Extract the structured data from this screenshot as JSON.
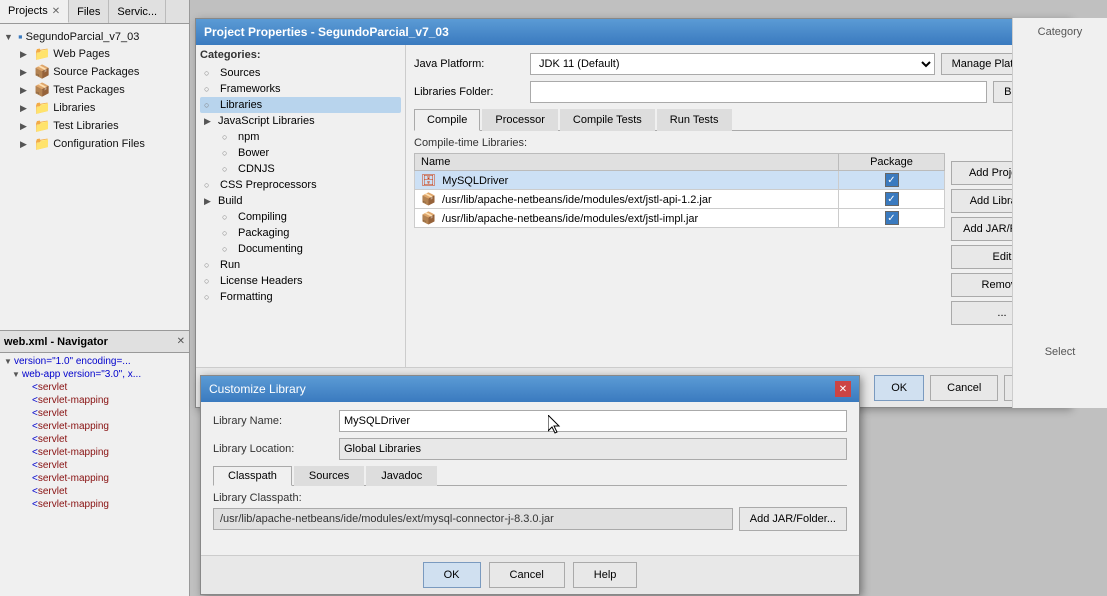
{
  "app": {
    "title": "Project Properties - SegundoParcial_v7_03"
  },
  "tabs": {
    "projects": "Projects",
    "files": "Files",
    "services": "Servic..."
  },
  "left_panel": {
    "project_name": "SegundoParcial_v7_03",
    "tree_items": [
      {
        "label": "Web Pages",
        "icon": "folder",
        "depth": 1
      },
      {
        "label": "Source Packages",
        "icon": "pkg",
        "depth": 1
      },
      {
        "label": "Test Packages",
        "icon": "pkg",
        "depth": 1
      },
      {
        "label": "Libraries",
        "icon": "folder",
        "depth": 1
      },
      {
        "label": "Test Libraries",
        "icon": "folder",
        "depth": 1
      },
      {
        "label": "Configuration Files",
        "icon": "folder",
        "depth": 1
      }
    ]
  },
  "navigator": {
    "title": "web.xml - Navigator",
    "tree_items": [
      {
        "label": "version=\"1.0\" encoding=...",
        "type": "xml",
        "depth": 0
      },
      {
        "label": "web-app version=\"3.0\", x...",
        "type": "xml",
        "depth": 1
      },
      {
        "label": "servlet",
        "type": "tag",
        "depth": 2
      },
      {
        "label": "servlet-mapping",
        "type": "tag",
        "depth": 2
      },
      {
        "label": "servlet",
        "type": "tag",
        "depth": 2
      },
      {
        "label": "servlet-mapping",
        "type": "tag",
        "depth": 2
      },
      {
        "label": "servlet",
        "type": "tag",
        "depth": 2
      },
      {
        "label": "servlet-mapping",
        "type": "tag",
        "depth": 2
      },
      {
        "label": "servlet",
        "type": "tag",
        "depth": 2
      },
      {
        "label": "servlet-mapping",
        "type": "tag",
        "depth": 2
      },
      {
        "label": "servlet",
        "type": "tag",
        "depth": 2
      },
      {
        "label": "servlet-mapping",
        "type": "tag",
        "depth": 2
      }
    ]
  },
  "main_dialog": {
    "title": "Project Properties - SegundoParcial_v7_03",
    "categories_label": "Categories:",
    "categories": [
      {
        "label": "Sources",
        "depth": 0,
        "selected": false
      },
      {
        "label": "Frameworks",
        "depth": 0,
        "selected": false
      },
      {
        "label": "Libraries",
        "depth": 0,
        "selected": true
      },
      {
        "label": "JavaScript Libraries",
        "depth": 0,
        "selected": false
      },
      {
        "label": "npm",
        "depth": 1,
        "selected": false
      },
      {
        "label": "Bower",
        "depth": 1,
        "selected": false
      },
      {
        "label": "CDNJS",
        "depth": 1,
        "selected": false
      },
      {
        "label": "CSS Preprocessors",
        "depth": 0,
        "selected": false
      },
      {
        "label": "Build",
        "depth": 0,
        "selected": false
      },
      {
        "label": "Compiling",
        "depth": 1,
        "selected": false
      },
      {
        "label": "Packaging",
        "depth": 1,
        "selected": false
      },
      {
        "label": "Documenting",
        "depth": 1,
        "selected": false
      },
      {
        "label": "Run",
        "depth": 0,
        "selected": false
      },
      {
        "label": "License Headers",
        "depth": 0,
        "selected": false
      },
      {
        "label": "Formatting",
        "depth": 0,
        "selected": false
      }
    ],
    "java_platform_label": "Java Platform:",
    "java_platform_value": "JDK 11 (Default)",
    "libraries_folder_label": "Libraries Folder:",
    "libraries_folder_value": "",
    "manage_platforms_btn": "Manage Platforms...",
    "browse_btn": "Browse...",
    "tabs": [
      "Compile",
      "Processor",
      "Compile Tests",
      "Run Tests"
    ],
    "active_tab": "Compile",
    "compile_time_label": "Compile-time Libraries:",
    "table_headers": [
      "Name",
      "Package"
    ],
    "libraries": [
      {
        "name": "MySQLDriver",
        "path": "",
        "type": "db",
        "checked": true,
        "selected": true
      },
      {
        "name": "",
        "path": "/usr/lib/apache-netbeans/ide/modules/ext/jstl-api-1.2.jar",
        "type": "jar",
        "checked": true,
        "selected": false
      },
      {
        "name": "",
        "path": "/usr/lib/apache-netbeans/ide/modules/ext/jstl-impl.jar",
        "type": "jar",
        "checked": true,
        "selected": false
      }
    ],
    "right_buttons": [
      "Add Project...",
      "Add Library...",
      "Add JAR/Folder",
      "Edit",
      "Remove",
      "..."
    ],
    "footer_buttons": [
      "OK",
      "Cancel",
      "Help"
    ],
    "category_label": "Category",
    "select_label": "Select"
  },
  "customize_dialog": {
    "title": "Customize Library",
    "library_name_label": "Library Name:",
    "library_name_value": "MySQLDriver",
    "library_location_label": "Library Location:",
    "library_location_value": "Global Libraries",
    "tabs": [
      "Classpath",
      "Sources",
      "Javadoc"
    ],
    "active_tab": "Classpath",
    "classpath_label": "Library Classpath:",
    "classpath_value": "/usr/lib/apache-netbeans/ide/modules/ext/mysql-connector-j-8.3.0.jar",
    "add_jar_btn": "Add JAR/Folder...",
    "footer_buttons": [
      "OK",
      "Cancel",
      "Help"
    ]
  }
}
